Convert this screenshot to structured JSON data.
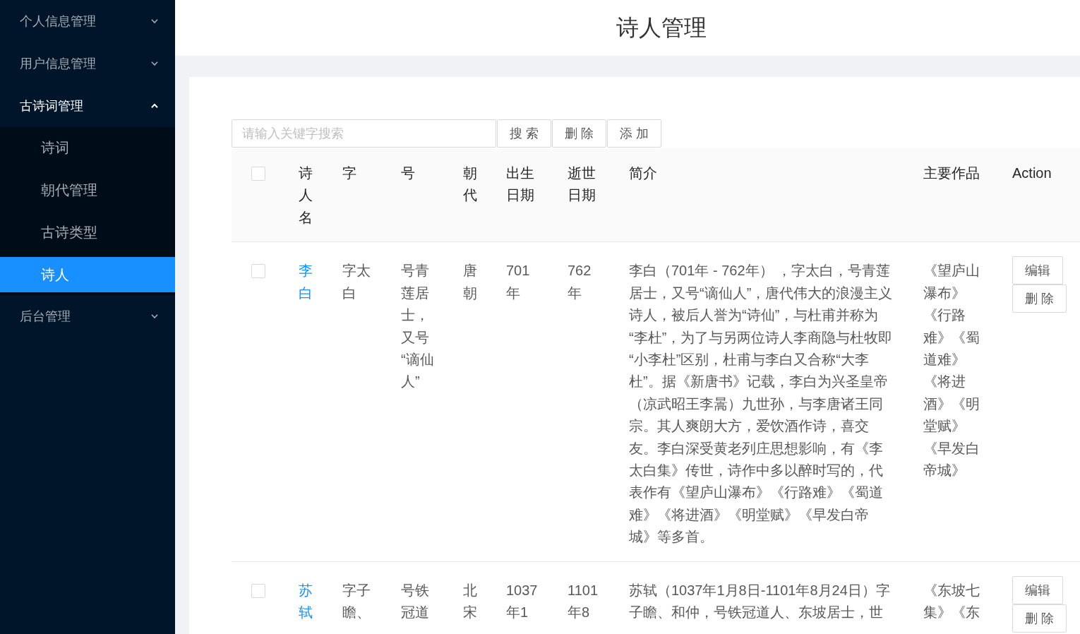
{
  "sidebar": {
    "items": [
      {
        "label": "个人信息管理",
        "expanded": false
      },
      {
        "label": "用户信息管理",
        "expanded": false
      },
      {
        "label": "古诗词管理",
        "expanded": true,
        "children": [
          {
            "label": "诗词",
            "selected": false
          },
          {
            "label": "朝代管理",
            "selected": false
          },
          {
            "label": "古诗类型",
            "selected": false
          },
          {
            "label": "诗人",
            "selected": true
          }
        ]
      },
      {
        "label": "后台管理",
        "expanded": false
      }
    ]
  },
  "page_title": "诗人管理",
  "toolbar": {
    "search": {
      "placeholder": "请输入关键字搜索"
    },
    "buttons": [
      "搜 索",
      "删 除",
      "添 加"
    ]
  },
  "table": {
    "select_all": {
      "checked": false
    },
    "columns": [
      {
        "label": "诗人名",
        "kind": "link"
      },
      {
        "label": "字",
        "kind": "text"
      },
      {
        "label": "号",
        "kind": "text"
      },
      {
        "label": "朝代",
        "kind": "text"
      },
      {
        "label": "出生日期",
        "kind": "text"
      },
      {
        "label": "逝世日期",
        "kind": "text"
      },
      {
        "label": "简介",
        "kind": "text"
      },
      {
        "label": "主要作品",
        "kind": "text"
      },
      {
        "label": "Action",
        "kind": "actions"
      }
    ],
    "rows": [
      {
        "checked": false,
        "cells": [
          "李白",
          "字太白",
          "号青莲居士，又号“谪仙人”",
          "唐朝",
          "701年",
          "762年",
          "李白（701年 - 762年） ，字太白，号青莲居士，又号“谪仙人”，唐代伟大的浪漫主义诗人，被后人誉为“诗仙”，与杜甫并称为“李杜”，为了与另两位诗人李商隐与杜牧即“小李杜”区别，杜甫与李白又合称“大李杜”。据《新唐书》记载，李白为兴圣皇帝（凉武昭王李暠）九世孙，与李唐诸王同宗。其人爽朗大方，爱饮酒作诗，喜交友。李白深受黄老列庄思想影响，有《李太白集》传世，诗作中多以醉时写的，代表作有《望庐山瀑布》《行路难》《蜀道难》《将进酒》《明堂赋》《早发白帝城》等多首。",
          "《望庐山瀑布》《行路难》《蜀道难》《将进酒》《明堂赋》《早发白帝城》"
        ],
        "actions": [
          "编辑",
          "删 除"
        ]
      },
      {
        "checked": false,
        "cells": [
          "苏轼",
          "字子瞻、",
          "号铁冠道",
          "北宋",
          "1037年1",
          "1101年8",
          "苏轼（1037年1月8日-1101年8月24日）字子瞻、和仲，号铁冠道人、东坡居士，世",
          "《东坡七集》《东"
        ],
        "actions": [
          "编辑",
          "删 除"
        ]
      }
    ]
  }
}
